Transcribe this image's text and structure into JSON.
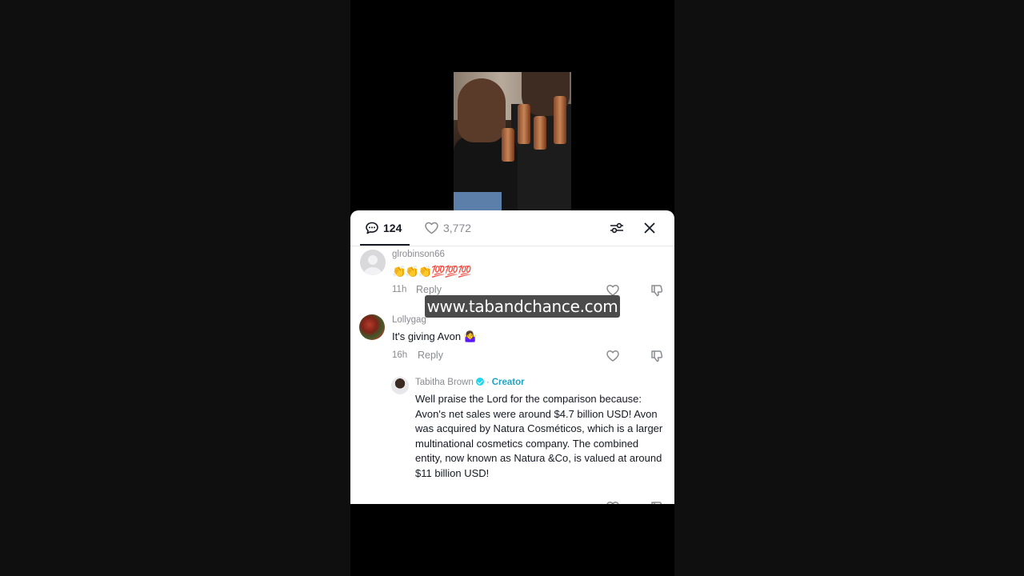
{
  "tabs": {
    "comments_count": "124",
    "likes_count": "3,772"
  },
  "icons": {
    "comment": "comment-bubble-icon",
    "heart": "heart-icon",
    "filter": "filter-sliders-icon",
    "close": "close-icon",
    "dislike": "thumbs-down-icon"
  },
  "colors": {
    "accent_creator": "#20a4c6",
    "verified": "#20d5ec",
    "text_primary": "#161823",
    "text_secondary": "#8a8b91"
  },
  "comments": [
    {
      "username": "glrobinson66",
      "text": "👏👏👏💯💯💯",
      "time": "11h",
      "reply_label": "Reply"
    },
    {
      "username": "Lollygag",
      "text": "It's giving Avon 🤷‍♀️",
      "time": "16h",
      "reply_label": "Reply"
    }
  ],
  "reply": {
    "username": "Tabitha Brown",
    "separator": "·",
    "badge": "Creator",
    "text": "Well praise the Lord for the comparison because: Avon's net sales were around $4.7 billion USD! Avon was acquired by Natura Cosméticos, which is a larger multinational cosmetics company. The combined entity, now known as Natura &Co, is valued at around $11 billion USD!"
  },
  "watermark": "www.tabandchance.com"
}
